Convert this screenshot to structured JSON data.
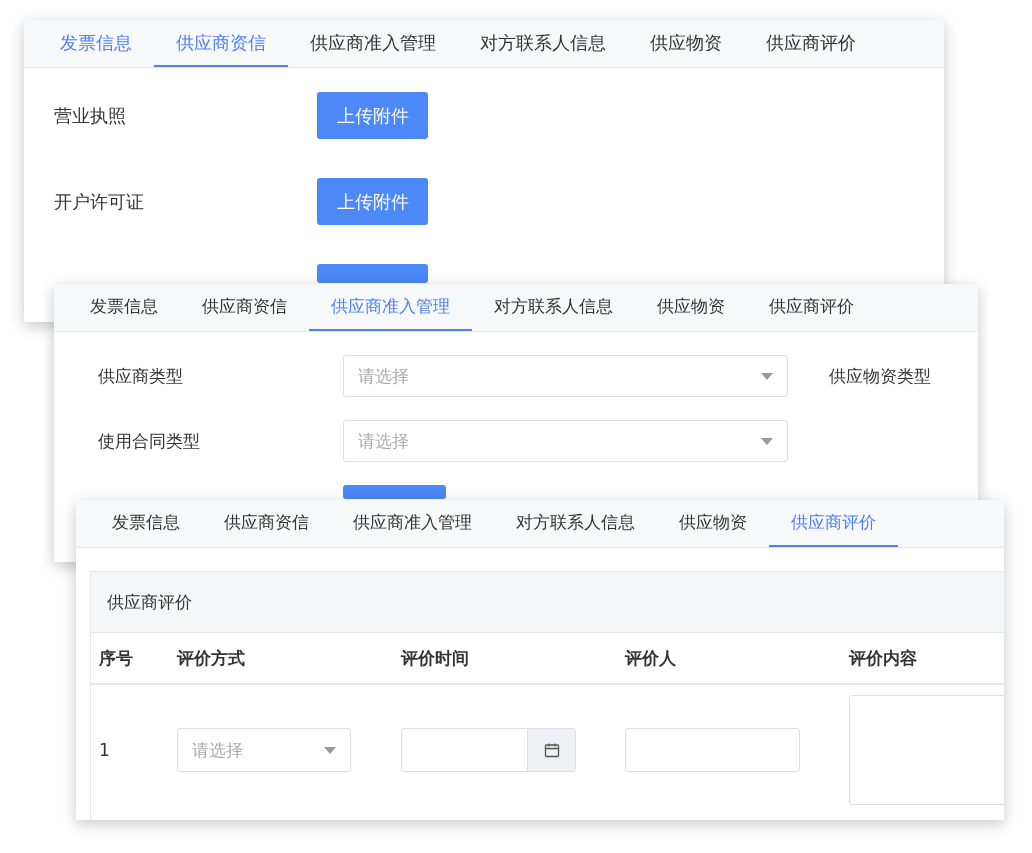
{
  "panels": [
    {
      "kind": "credit",
      "tabs": [
        {
          "label": "发票信息",
          "selected": false,
          "highlighted": true
        },
        {
          "label": "供应商资信",
          "selected": true,
          "highlighted": false
        },
        {
          "label": "供应商准入管理",
          "selected": false,
          "highlighted": false
        },
        {
          "label": "对方联系人信息",
          "selected": false,
          "highlighted": false
        },
        {
          "label": "供应物资",
          "selected": false,
          "highlighted": false
        },
        {
          "label": "供应商评价",
          "selected": false,
          "highlighted": false
        }
      ],
      "rows": [
        {
          "kind": "full",
          "label": "营业执照",
          "button": "上传附件"
        },
        {
          "kind": "full",
          "label": "开户许可证",
          "button": "上传附件"
        },
        {
          "kind": "partial"
        }
      ]
    },
    {
      "kind": "admission",
      "tabs": [
        {
          "label": "发票信息",
          "selected": false,
          "highlighted": false
        },
        {
          "label": "供应商资信",
          "selected": false,
          "highlighted": false
        },
        {
          "label": "供应商准入管理",
          "selected": true,
          "highlighted": false
        },
        {
          "label": "对方联系人信息",
          "selected": false,
          "highlighted": false
        },
        {
          "label": "供应物资",
          "selected": false,
          "highlighted": false
        },
        {
          "label": "供应商评价",
          "selected": false,
          "highlighted": false
        }
      ],
      "fields": [
        {
          "kind": "select",
          "label": "供应商类型",
          "placeholder": "请选择",
          "side_label": "供应物资类型"
        },
        {
          "kind": "select",
          "label": "使用合同类型",
          "placeholder": "请选择"
        },
        {
          "kind": "partial"
        }
      ]
    },
    {
      "kind": "evaluation",
      "tabs": [
        {
          "label": "发票信息",
          "selected": false,
          "highlighted": false
        },
        {
          "label": "供应商资信",
          "selected": false,
          "highlighted": false
        },
        {
          "label": "供应商准入管理",
          "selected": false,
          "highlighted": false
        },
        {
          "label": "对方联系人信息",
          "selected": false,
          "highlighted": false
        },
        {
          "label": "供应物资",
          "selected": false,
          "highlighted": false
        },
        {
          "label": "供应商评价",
          "selected": true,
          "highlighted": false
        }
      ],
      "section_title": "供应商评价",
      "table": {
        "columns": [
          "序号",
          "评价方式",
          "评价时间",
          "评价人",
          "评价内容"
        ],
        "rows": [
          {
            "index": "1",
            "method_placeholder": "请选择"
          }
        ]
      }
    }
  ]
}
